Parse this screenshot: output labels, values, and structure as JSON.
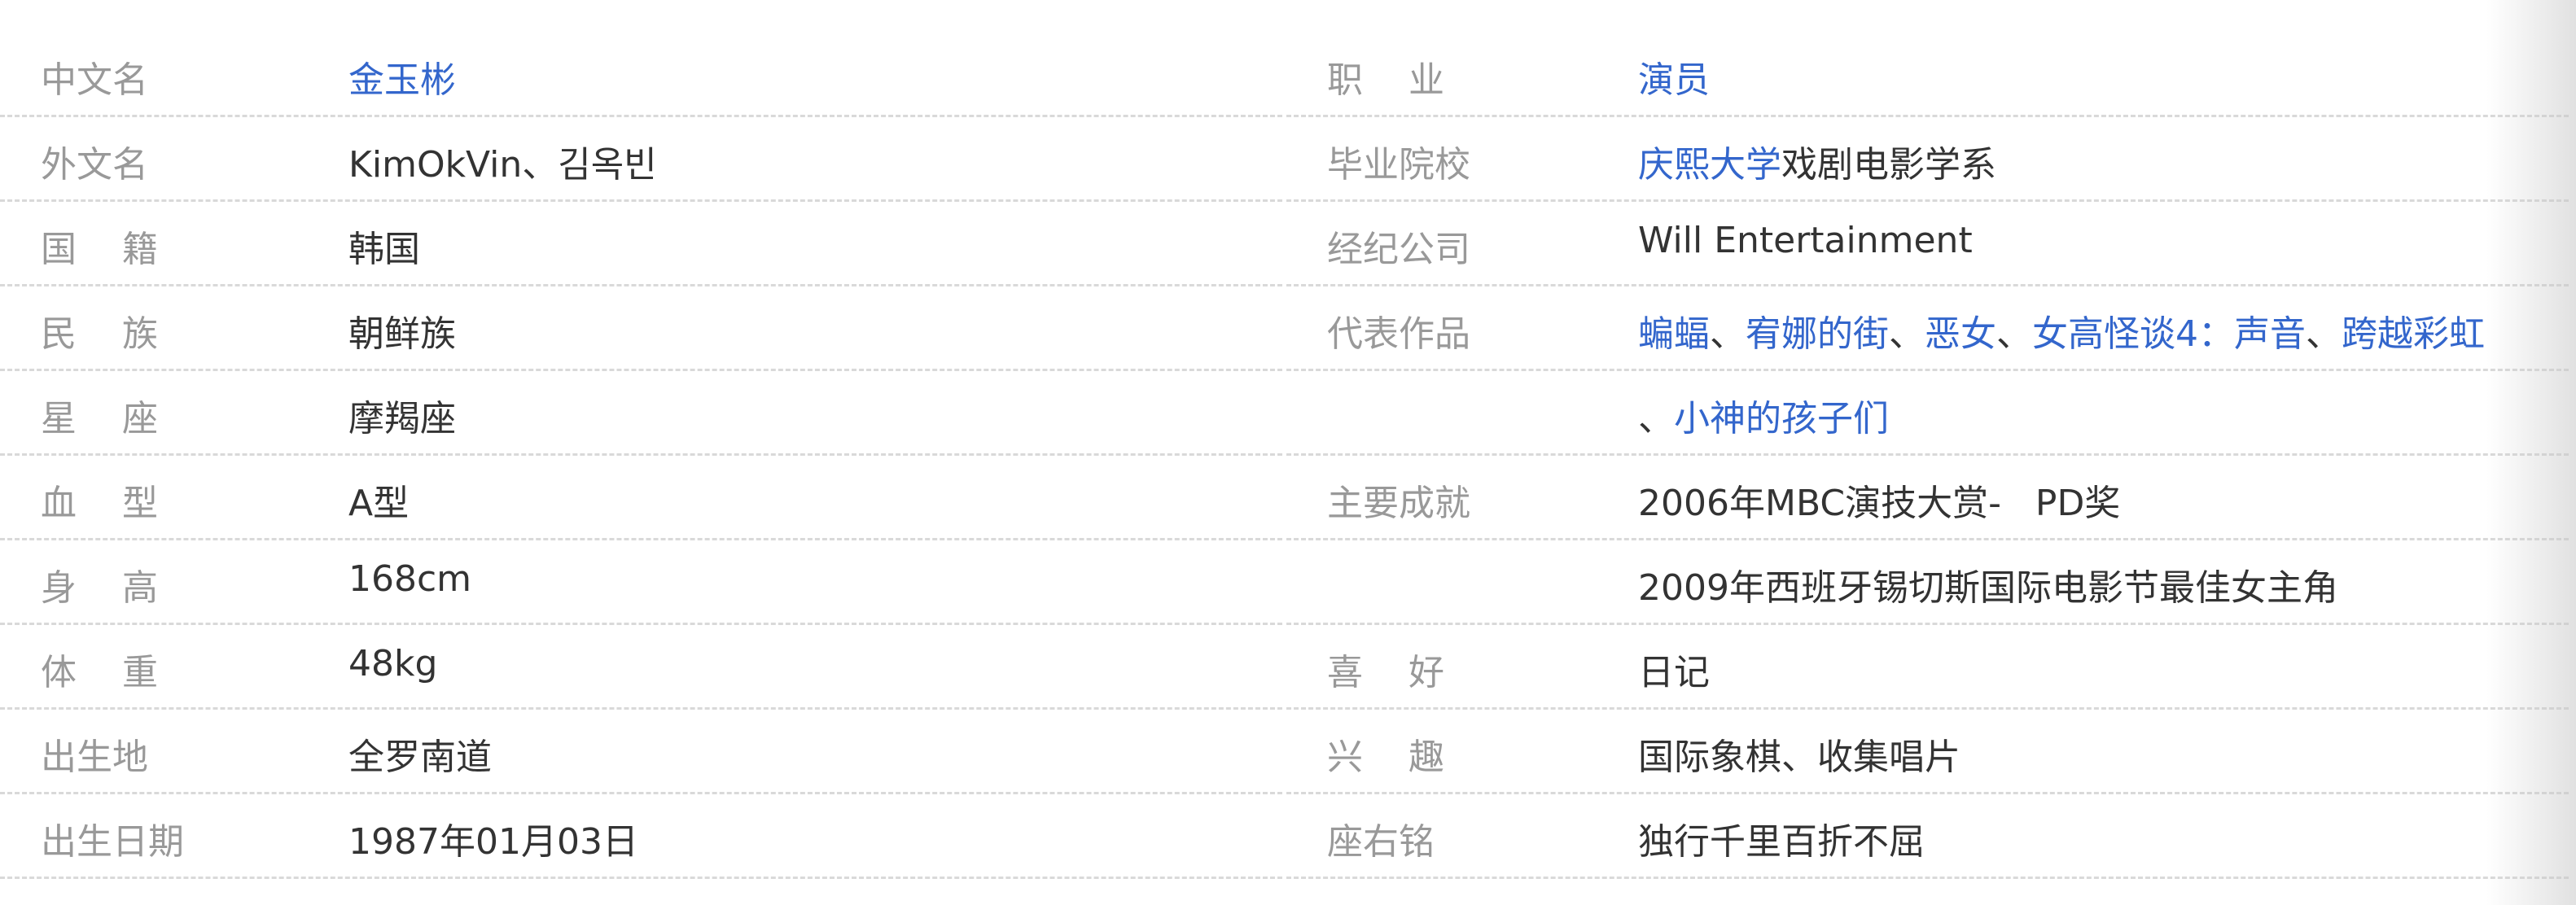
{
  "left": [
    {
      "label": "中文名",
      "value": "金玉彬",
      "link": true
    },
    {
      "label": "外文名",
      "value": "KimOkVin、김옥빈",
      "link": false
    },
    {
      "label": "国籍",
      "value": "韩国",
      "link": false
    },
    {
      "label": "民族",
      "value": "朝鲜族",
      "link": false
    },
    {
      "label": "星座",
      "value": "摩羯座",
      "link": false
    },
    {
      "label": "血型",
      "value": "A型",
      "link": false
    },
    {
      "label": "身高",
      "value": "168cm",
      "link": false
    },
    {
      "label": "体重",
      "value": "48kg",
      "link": false
    },
    {
      "label": "出生地",
      "value": "全罗南道",
      "link": false
    },
    {
      "label": "出生日期",
      "value": "1987年01月03日",
      "link": false
    }
  ],
  "right": {
    "occupation": {
      "label": "职业",
      "value": "演员"
    },
    "school": {
      "label": "毕业院校",
      "link_text": "庆熙大学",
      "rest_text": "戏剧电影学系"
    },
    "agency": {
      "label": "经纪公司",
      "value": "Will Entertainment"
    },
    "works": {
      "label": "代表作品",
      "line1": [
        "蝙蝠",
        "宥娜的街",
        "恶女",
        "女高怪谈4：声音",
        "跨越彩虹"
      ],
      "separator": "、",
      "line2": "小神的孩子们"
    },
    "achievements": {
      "label": "主要成就",
      "items": [
        "2006年MBC演技大赏-   PD奖",
        "2009年西班牙锡切斯国际电影节最佳女主角"
      ]
    },
    "hobby": {
      "label": "喜好",
      "value": "日记"
    },
    "interest": {
      "label": "兴趣",
      "value": "国际象棋、收集唱片"
    },
    "motto": {
      "label": "座右铭",
      "value": "独行千里百折不屈"
    }
  }
}
